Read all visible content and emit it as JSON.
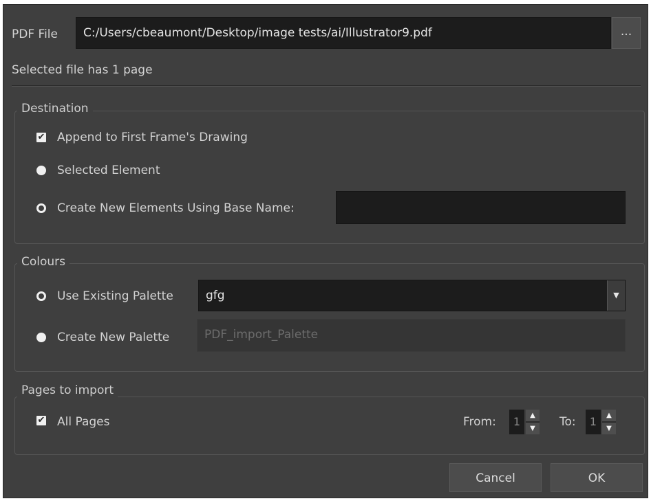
{
  "pdf_file": {
    "label": "PDF File",
    "path": "C:/Users/cbeaumont/Desktop/image tests/ai/Illustrator9.pdf",
    "browse_label": "..."
  },
  "status_text": "Selected file has 1 page",
  "destination": {
    "legend": "Destination",
    "append_label": "Append to First Frame's Drawing",
    "append_checked": true,
    "selected_element_label": "Selected Element",
    "create_new_label": "Create New Elements Using Base Name:",
    "base_name_value": ""
  },
  "colours": {
    "legend": "Colours",
    "use_existing_label": "Use Existing Palette",
    "existing_palette_value": "gfg",
    "create_new_label": "Create New Palette",
    "new_palette_placeholder": "PDF_import_Palette"
  },
  "pages": {
    "legend": "Pages to import",
    "all_pages_label": "All Pages",
    "all_pages_checked": true,
    "from_label": "From:",
    "from_value": "1",
    "to_label": "To:",
    "to_value": "1"
  },
  "buttons": {
    "cancel": "Cancel",
    "ok": "OK"
  },
  "icons": {
    "check": "✔",
    "dropdown": "▼",
    "spin_up": "▲",
    "spin_down": "▼"
  }
}
